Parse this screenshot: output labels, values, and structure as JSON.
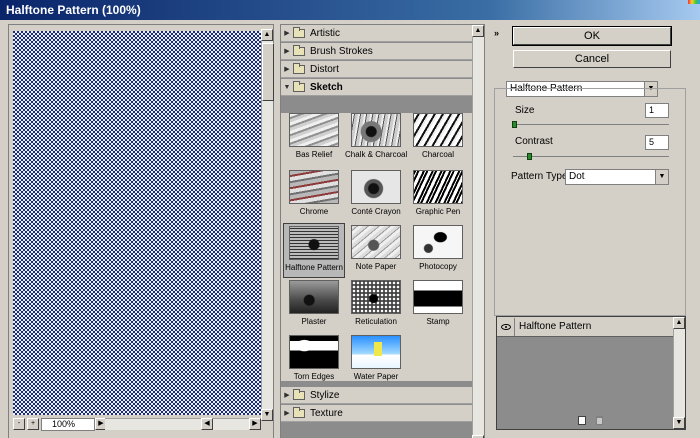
{
  "window": {
    "title": "Halftone Pattern (100%)"
  },
  "preview": {
    "zoom": "100%",
    "zoom_out": "-",
    "zoom_in": "+"
  },
  "gallery": {
    "categories": [
      {
        "label": "Artistic"
      },
      {
        "label": "Brush Strokes"
      },
      {
        "label": "Distort"
      },
      {
        "label": "Sketch"
      },
      {
        "label": "Stylize"
      },
      {
        "label": "Texture"
      }
    ],
    "filters": [
      {
        "label": "Bas Relief"
      },
      {
        "label": "Chalk & Charcoal"
      },
      {
        "label": "Charcoal"
      },
      {
        "label": "Chrome"
      },
      {
        "label": "Conté Crayon"
      },
      {
        "label": "Graphic Pen"
      },
      {
        "label": "Halftone Pattern"
      },
      {
        "label": "Note Paper"
      },
      {
        "label": "Photocopy"
      },
      {
        "label": "Plaster"
      },
      {
        "label": "Reticulation"
      },
      {
        "label": "Stamp"
      },
      {
        "label": "Torn Edges"
      },
      {
        "label": "Water Paper"
      }
    ],
    "selected_filter": "Halftone Pattern"
  },
  "buttons": {
    "ok": "OK",
    "cancel": "Cancel",
    "collapse": "»"
  },
  "settings": {
    "filter_select": "Halftone Pattern",
    "size": {
      "label": "Size",
      "value": "1"
    },
    "contrast": {
      "label": "Contrast",
      "value": "5"
    },
    "pattern_type": {
      "label": "Pattern Type:",
      "value": "Dot"
    }
  },
  "layers": {
    "items": [
      {
        "label": "Halftone Pattern"
      }
    ]
  },
  "colors": {
    "title_bar": "#0a246a",
    "preview_dark": "#1c2c7a",
    "dialog_bg": "#d4d0c8"
  }
}
